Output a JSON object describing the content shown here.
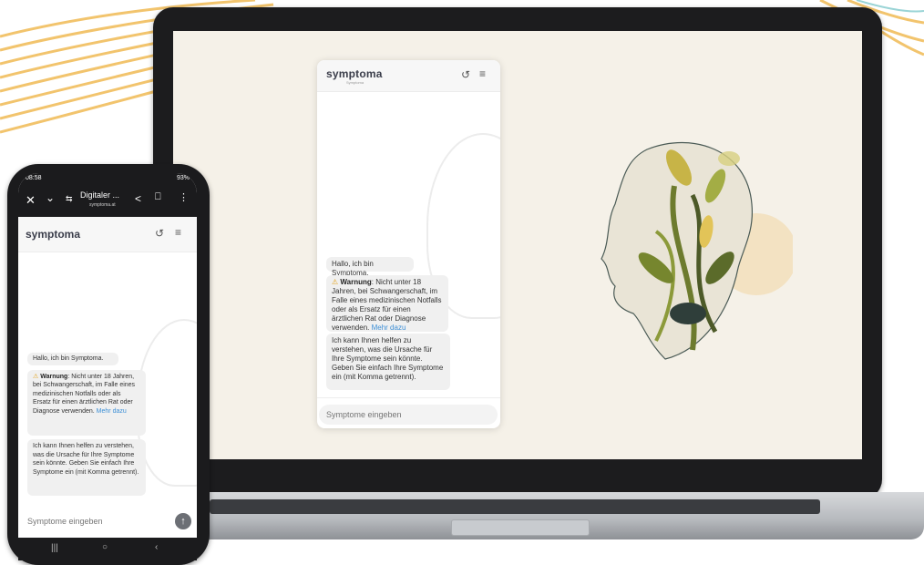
{
  "laptop_widget": {
    "logo": "symptoma",
    "logo_sub": "Symptoma",
    "greeting": "Hallo, ich bin Symptoma.",
    "warning_label": "Warnung",
    "warning_text": ": Nicht unter 18 Jahren, bei Schwangerschaft, im Falle eines medizinischen Notfalls oder als Ersatz für einen ärztlichen Rat oder Diagnose verwenden.",
    "more_link": "Mehr dazu",
    "help_text": "Ich kann Ihnen helfen zu verstehen, was die Ursache für Ihre Symptome sein könnte. Geben Sie einfach Ihre Symptome ein (mit Komma getrennt).",
    "input_placeholder": "Symptome eingeben"
  },
  "phone": {
    "time": "08:58",
    "battery": "93%",
    "tab_title": "Digitaler ...",
    "tab_url": "symptoma.at",
    "logo": "symptoma",
    "greeting": "Hallo, ich bin Symptoma.",
    "warning_label": "Warnung",
    "warning_text": ": Nicht unter 18 Jahren, bei Schwangerschaft, im Falle eines medizinischen Notfalls oder als Ersatz für einen ärztlichen Rat oder Diagnose verwenden.",
    "more_link": "Mehr dazu",
    "help_text": "Ich kann Ihnen helfen zu verstehen, was die Ursache für Ihre Symptome sein könnte. Geben Sie einfach Ihre Symptome ein (mit Komma getrennt).",
    "input_placeholder": "Symptome eingeben"
  },
  "icons": {
    "reset": "reset-icon",
    "menu": "menu-icon",
    "close": "close-icon",
    "chevron": "chevron-down-icon",
    "tabs": "tabs-icon",
    "share": "share-icon",
    "bookmark": "bookmark-icon",
    "more": "more-vert-icon",
    "send": "send-arrow-icon",
    "warning": "warning-icon"
  },
  "colors": {
    "screen_bg": "#f5f1e8",
    "link": "#3d8fd6",
    "warning": "#e3a21a",
    "stripe": "#f2c46d"
  }
}
